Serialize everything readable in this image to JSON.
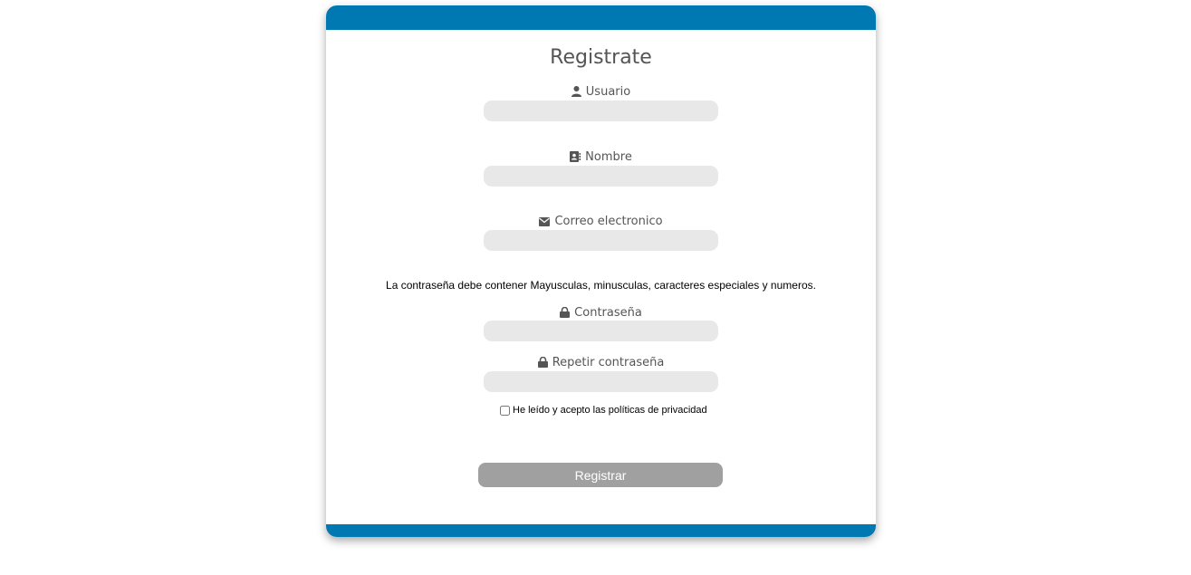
{
  "form": {
    "title": "Registrate",
    "fields": [
      {
        "label": "Usuario",
        "icon": "user-icon",
        "value": "",
        "placeholder": ""
      },
      {
        "label": "Nombre",
        "icon": "contact-card-icon",
        "value": "",
        "placeholder": ""
      },
      {
        "label": "Correo electronico",
        "icon": "envelope-icon",
        "value": "",
        "placeholder": ""
      },
      {
        "label": "Contraseña",
        "icon": "lock-icon",
        "value": "",
        "placeholder": ""
      },
      {
        "label": "Repetir contraseña",
        "icon": "lock-icon",
        "value": "",
        "placeholder": ""
      }
    ],
    "password_hint": "La contraseña debe contener Mayusculas, minusculas, caracteres especiales y numeros.",
    "privacy_label": "He leído y acepto las políticas de privacidad",
    "privacy_checked": false,
    "submit_label": "Registrar"
  },
  "colors": {
    "accent": "#0078b1",
    "input_bg": "#e8e8e8",
    "button_bg": "#a0a0a0",
    "label_text": "#555555"
  }
}
